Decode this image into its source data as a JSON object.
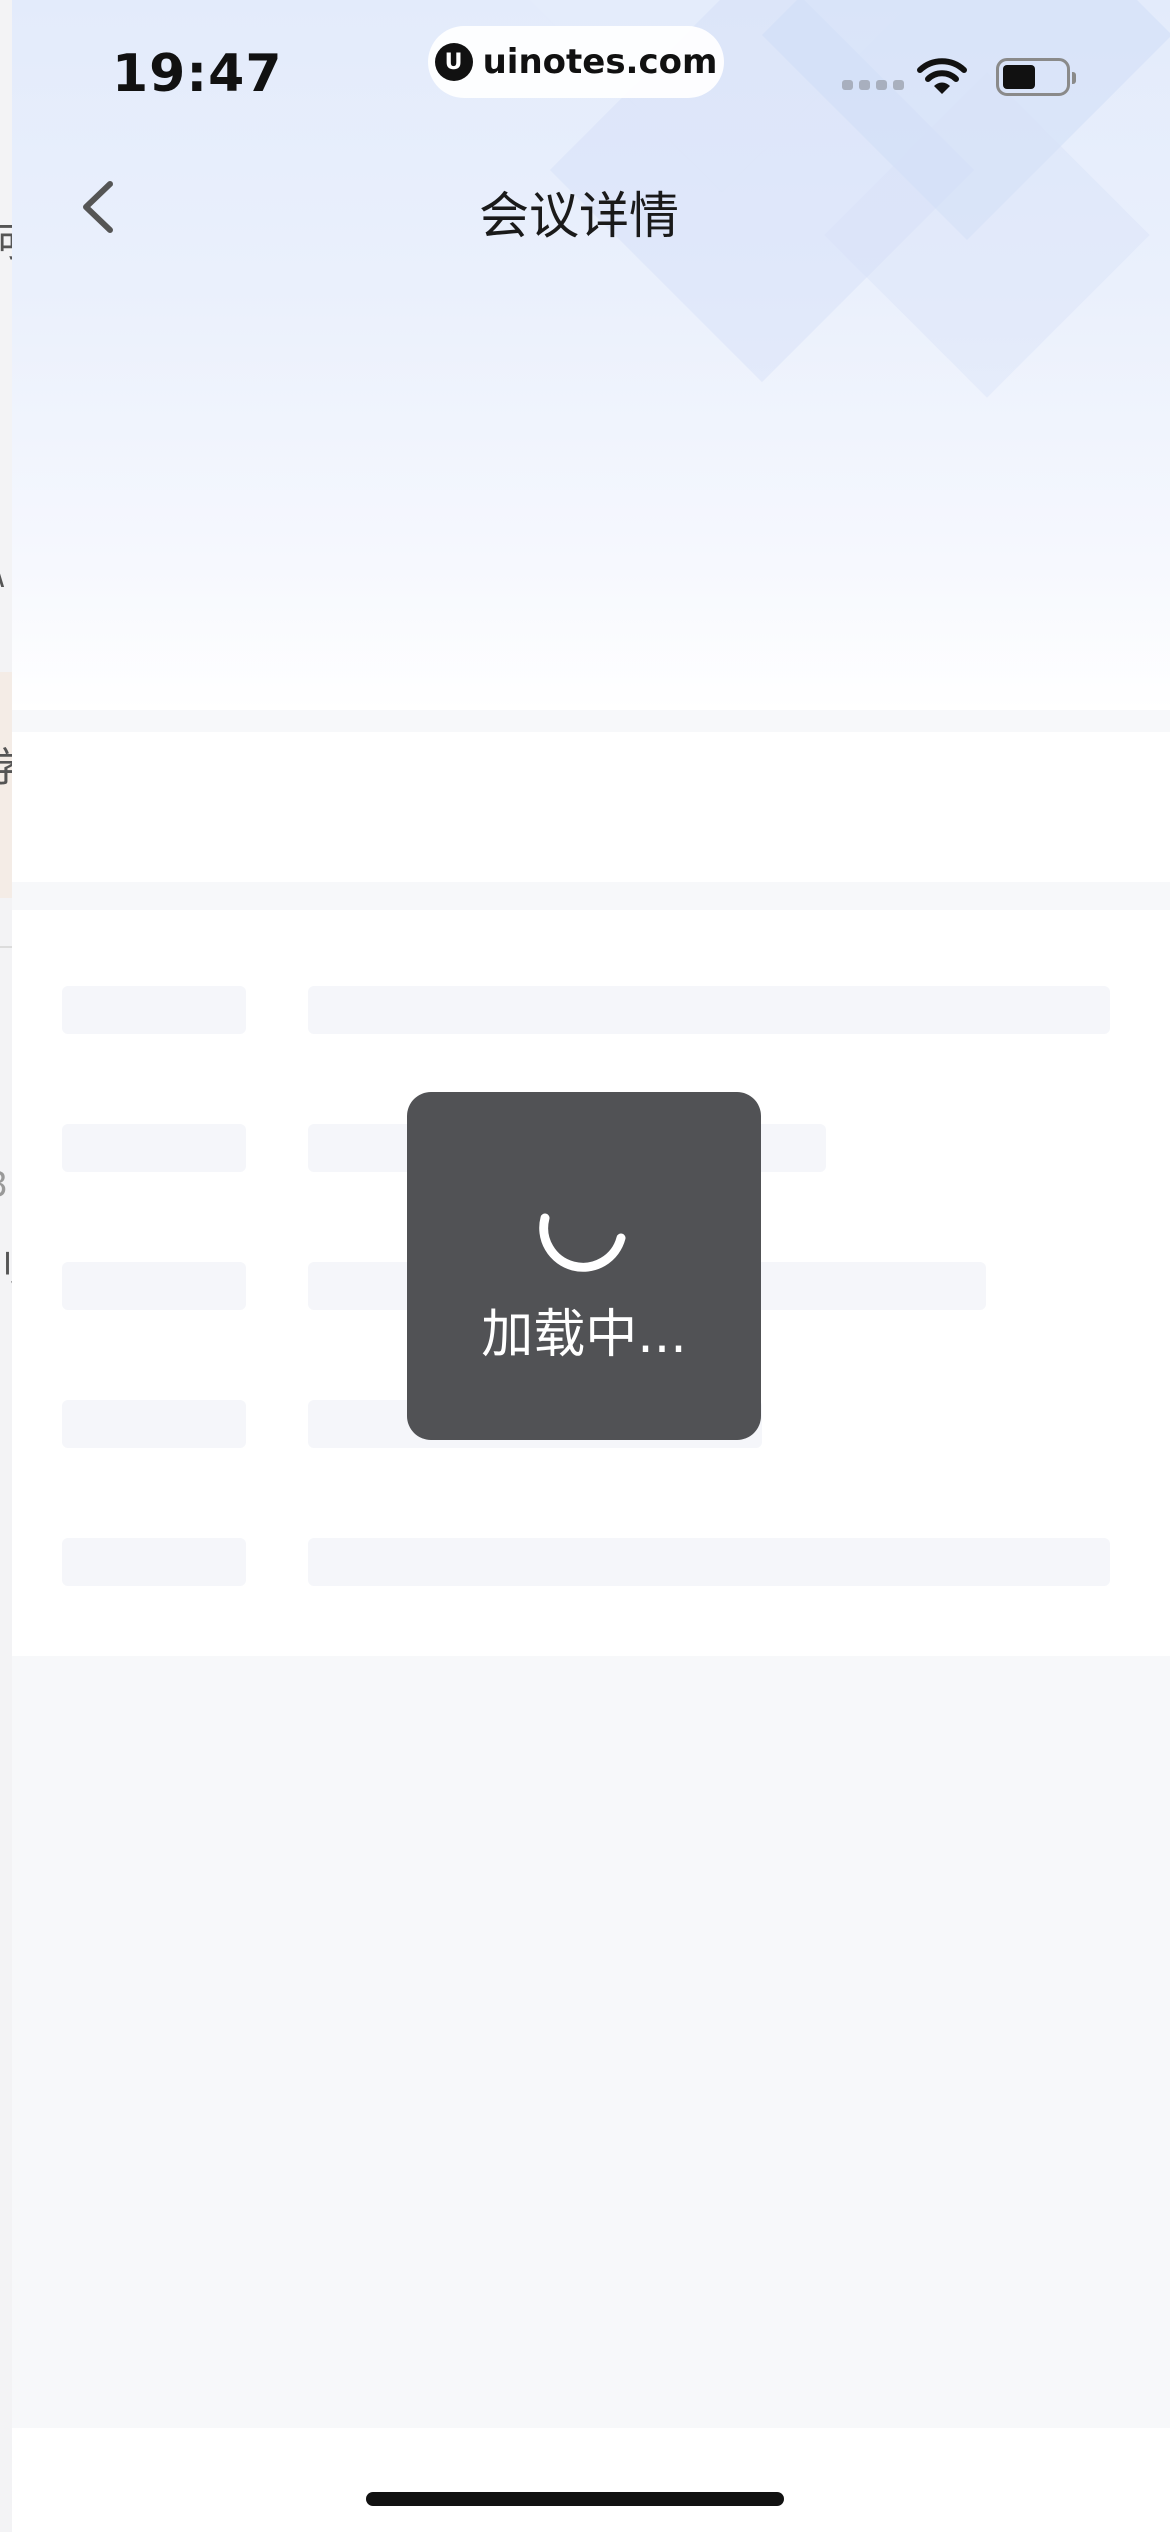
{
  "status_bar": {
    "time": "19:47",
    "url": "uinotes.com",
    "logo_glyph": "U"
  },
  "nav": {
    "title": "会议详情",
    "back_icon": "chevron-left-icon"
  },
  "loading": {
    "text": "加载中..."
  },
  "under_page_fragments": [
    "河",
    "∧",
    "学",
    "8",
    "刂"
  ],
  "colors": {
    "hero_top": "#e3ebfb",
    "page_bg": "#f7f8fa",
    "skeleton": "#f5f6fa",
    "toast_bg": "#444548"
  }
}
